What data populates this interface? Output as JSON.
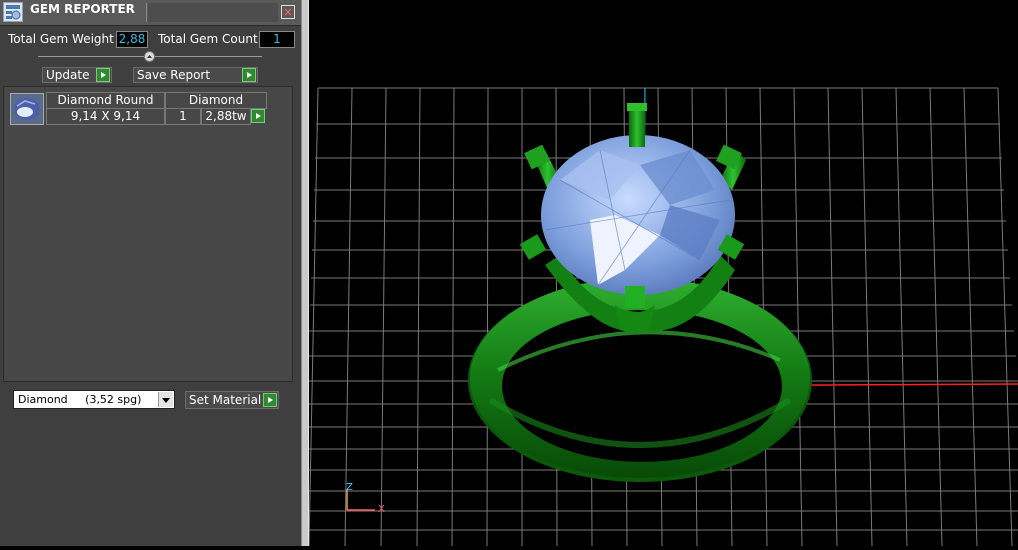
{
  "panel": {
    "title": "GEM REPORTER",
    "close_glyph": "✕",
    "total_weight_label": "Total Gem Weight",
    "total_weight_value": "2,88",
    "total_count_label": "Total Gem Count",
    "total_count_value": "1",
    "update_label": "Update",
    "save_report_label": "Save Report",
    "gem_list": [
      {
        "name": "Diamond Round",
        "material": "Diamond",
        "size": "9,14 X 9,14",
        "count": "1",
        "weight": "2,88tw"
      }
    ],
    "material_select": "Diamond     (3,52 spg)",
    "set_material_label": "Set Material"
  },
  "viewport": {
    "axis_y_label": "Z",
    "axis_x_label": "X"
  },
  "colors": {
    "accent_value": "#33bfe0",
    "button_green": "#2e8a2e",
    "ring_green": "#1e9a1e",
    "gem_blue": "#7ea2df",
    "grid": "#7a7a7a",
    "x_axis": "#ff2020",
    "y_axis": "#20d0e0"
  },
  "icons": [
    "gem-reporter-icon",
    "close-icon",
    "play-arrow-icon",
    "diamond-thumbnail-icon",
    "chevron-down-icon",
    "axis-triad-icon"
  ]
}
